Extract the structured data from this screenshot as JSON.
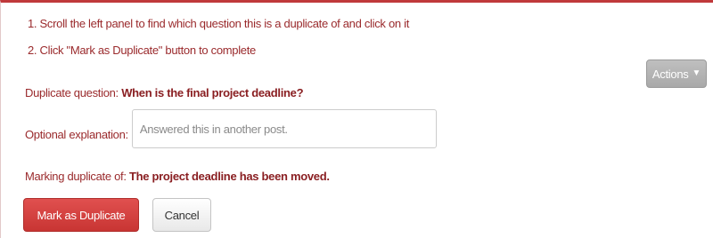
{
  "instructions": [
    "1. Scroll the left panel to find which question this is a duplicate of and click on it",
    "2. Click \"Mark as Duplicate\" button to complete"
  ],
  "actions": {
    "label": "Actions",
    "icon": "caret-down-icon"
  },
  "duplicate_question": {
    "label": "Duplicate question:",
    "value": "When is the final project deadline?"
  },
  "explanation": {
    "label": "Optional explanation:",
    "placeholder": "Answered this in another post.",
    "value": ""
  },
  "marking_duplicate": {
    "label": "Marking duplicate of:",
    "value": "The project deadline has been moved."
  },
  "buttons": {
    "mark_duplicate": "Mark as Duplicate",
    "cancel": "Cancel"
  },
  "colors": {
    "accent": "#c0393b",
    "label_text": "#9a2a2c",
    "primary_button": "#d9403e",
    "actions_button": "#b3b3b3"
  }
}
